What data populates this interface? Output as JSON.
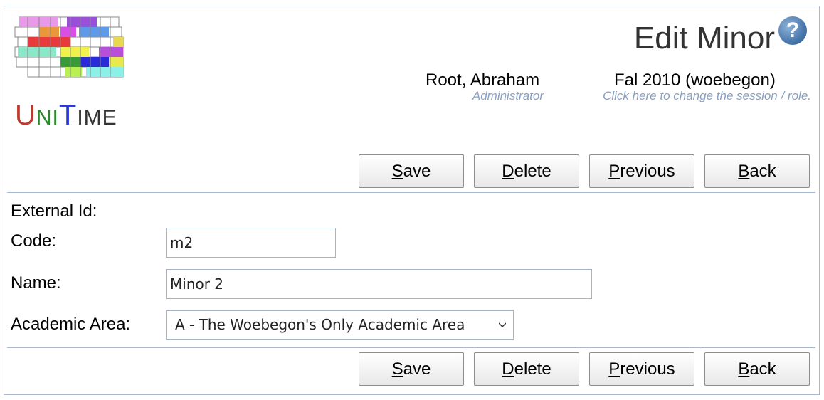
{
  "header": {
    "title": "Edit Minor",
    "help_icon": "?",
    "user_name": "Root, Abraham",
    "user_role": "Administrator",
    "session_name": "Fal 2010 (woebegon)",
    "session_hint": "Click here to change the session / role."
  },
  "logo": {
    "text_U": "U",
    "text_NI": "NI",
    "text_T": "T",
    "text_IME": "IME"
  },
  "buttons": {
    "save": {
      "access": "S",
      "rest": "ave"
    },
    "delete": {
      "access": "D",
      "rest": "elete"
    },
    "previous": {
      "access": "P",
      "rest": "revious"
    },
    "back": {
      "access": "B",
      "rest": "ack"
    }
  },
  "form": {
    "external_id_label": "External Id:",
    "code_label": "Code:",
    "code_value": "m2",
    "name_label": "Name:",
    "name_value": "Minor 2",
    "academic_area_label": "Academic Area:",
    "academic_area_value": "A - The Woebegon's Only Academic Area"
  }
}
